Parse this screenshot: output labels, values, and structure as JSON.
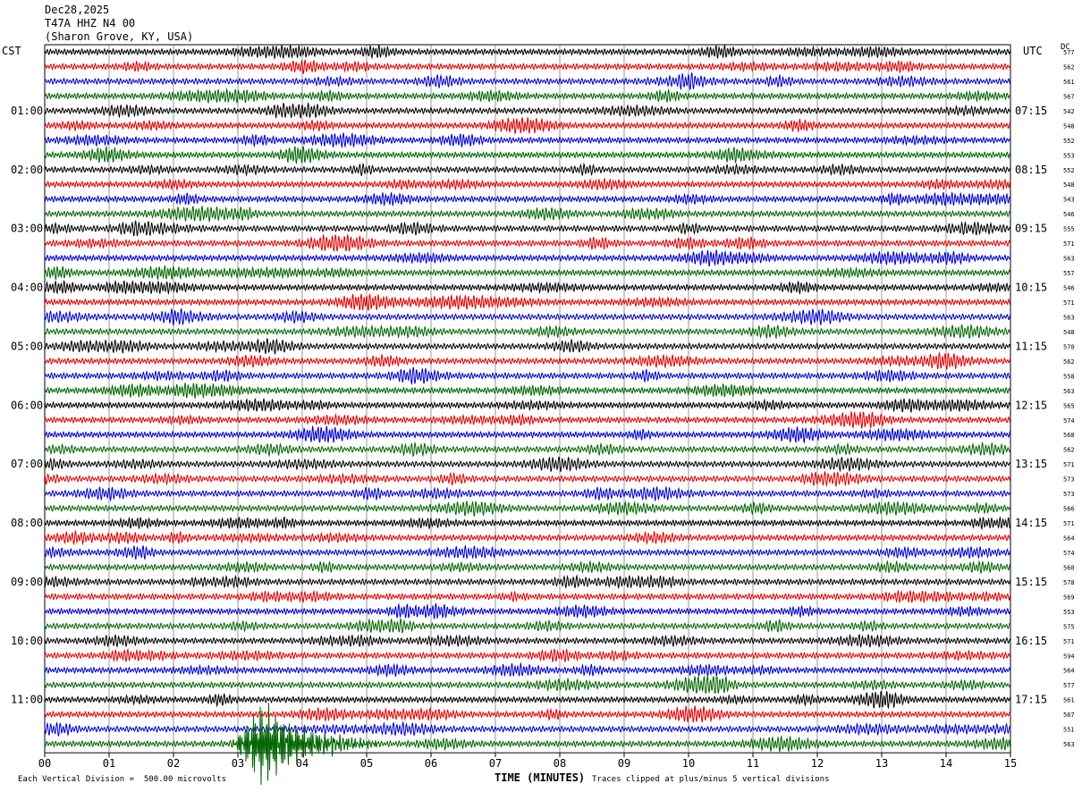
{
  "header": {
    "date": "Dec28,2025",
    "station": "T47A HHZ N4 00",
    "location": "(Sharon Grove, KY, USA)"
  },
  "left_axis_title": "CST",
  "right_axis_title": "UTC",
  "dc_label": "DC",
  "footer": {
    "scale": "Each Vertical Division =  500.00 microvolts",
    "clip": "Traces clipped at plus/minus 5 vertical divisions",
    "xlabel": "TIME (MINUTES)"
  },
  "colors": {
    "trace_cycle": [
      "#000000",
      "#dd0000",
      "#0000cc",
      "#006600"
    ],
    "grid": "#555555"
  },
  "chart_data": {
    "type": "helicorder",
    "xlabel": "TIME (MINUTES)",
    "xlim": [
      0,
      15
    ],
    "xticks": [
      "00",
      "01",
      "02",
      "03",
      "04",
      "05",
      "06",
      "07",
      "08",
      "09",
      "10",
      "11",
      "12",
      "13",
      "14",
      "15"
    ],
    "left_hour_labels": [
      "01:00",
      "02:00",
      "03:00",
      "04:00",
      "05:00",
      "06:00",
      "07:00",
      "08:00",
      "09:00",
      "10:00",
      "11:00"
    ],
    "right_hour_labels": [
      "07:15",
      "08:15",
      "09:15",
      "10:15",
      "11:15",
      "12:15",
      "13:15",
      "14:15",
      "15:15",
      "16:15",
      "17:15"
    ],
    "dc_offsets": [
      577,
      562,
      561,
      567,
      542,
      548,
      552,
      553,
      552,
      548,
      543,
      546,
      555,
      571,
      563,
      557,
      546,
      571,
      563,
      548,
      570,
      562,
      558,
      563,
      565,
      574,
      568,
      562,
      571,
      573,
      573,
      566,
      571,
      564,
      574,
      560,
      578,
      569,
      553,
      575,
      571,
      594,
      564,
      577,
      561,
      567,
      551,
      563
    ],
    "trace_minutes_per_line": 15,
    "traces_per_hour": 4,
    "event": {
      "line_index": 47,
      "start_minute": 2.9,
      "peak_minute": 3.4,
      "end_minute": 5.2,
      "note": "large clipped arrival on final green trace"
    }
  }
}
